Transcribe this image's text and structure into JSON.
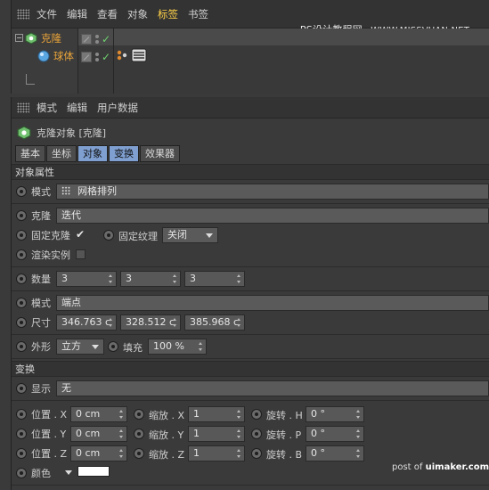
{
  "object_manager": {
    "menu": [
      "文件",
      "编辑",
      "查看",
      "对象",
      "标签",
      "书签"
    ],
    "active_menu_index": 4,
    "watermark_cn": "PS设计教程网",
    "watermark_url": "WWW.MISSVUAN.NET",
    "objects": [
      {
        "name": "克隆",
        "icon": "cloner-icon",
        "expanded": true
      },
      {
        "name": "球体",
        "icon": "sphere-icon",
        "child": true
      }
    ]
  },
  "attribute_manager": {
    "menu": [
      "模式",
      "编辑",
      "用户数据"
    ],
    "title": "克隆对象 [克隆]",
    "tabs": [
      "基本",
      "坐标",
      "对象",
      "变换",
      "效果器"
    ],
    "active_tabs": [
      "对象",
      "变换"
    ],
    "section_object": "对象属性",
    "mode_label": "模式",
    "mode_value": "网格排列",
    "clone_label": "克隆",
    "clone_value": "迭代",
    "fixed_clone_label": "固定克隆",
    "fixed_clone_checked": true,
    "fixed_texture_label": "固定纹理",
    "fixed_texture_value": "关闭",
    "render_instances_label": "渲染实例",
    "render_instances_checked": false,
    "count_label": "数量",
    "count_values": [
      "3",
      "3",
      "3"
    ],
    "mode2_label": "模式",
    "mode2_value": "端点",
    "size_label": "尺寸",
    "size_values": [
      "346.763 c",
      "328.512 c",
      "385.968 c"
    ],
    "shape_label": "外形",
    "shape_value": "立方",
    "fill_label": "填充",
    "fill_value": "100 %",
    "section_transform": "变换",
    "display_label": "显示",
    "display_value": "无",
    "pos_labels": [
      "位置 . X",
      "位置 . Y",
      "位置 . Z"
    ],
    "pos_values": [
      "0 cm",
      "0 cm",
      "0 cm"
    ],
    "scale_labels": [
      "缩放 . X",
      "缩放 . Y",
      "缩放 . Z"
    ],
    "scale_values": [
      "1",
      "1",
      "1"
    ],
    "rot_labels": [
      "旋转 . H",
      "旋转 . P",
      "旋转 . B"
    ],
    "rot_values": [
      "0 °",
      "0 °",
      "0 °"
    ],
    "color_label": "颜色",
    "color_value": "#ffffff"
  },
  "footer_watermark_prefix": "post of",
  "footer_watermark_site": "uimaker.com",
  "colors": {
    "accent_tab": "#7f9fd0",
    "active_menu": "#ffd24a",
    "object_label": "#e8a33a",
    "checkmark": "#6fd16f"
  }
}
